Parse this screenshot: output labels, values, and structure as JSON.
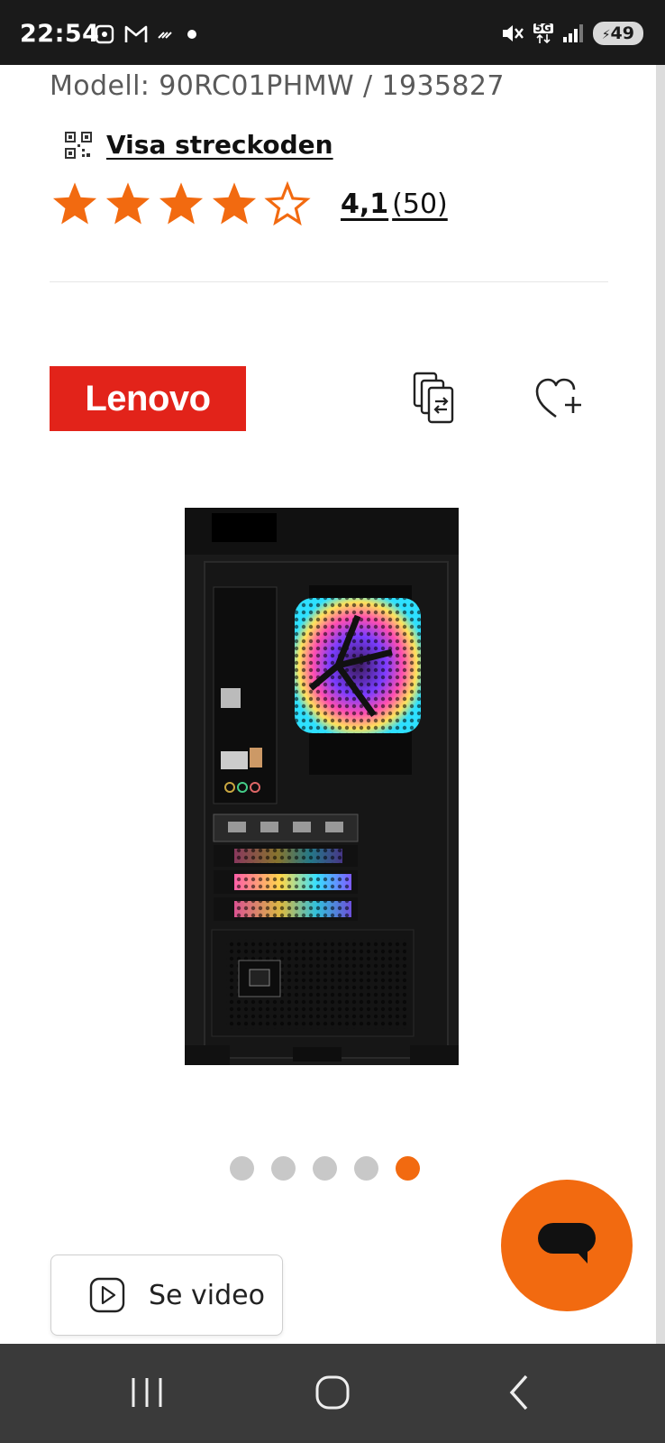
{
  "status_bar": {
    "time": "22:54",
    "battery": "49",
    "network": "5G"
  },
  "product": {
    "model_line": "Modell: 90RC01PHMW / 1935827",
    "barcode_link": "Visa streckoden",
    "rating": {
      "value": 4.1,
      "value_text": "4,1",
      "count_text": "(50)",
      "stars_filled": 4,
      "stars_total": 5
    },
    "brand_logo": "Lenovo"
  },
  "gallery": {
    "image_count": 5,
    "active_index": 4
  },
  "video_button": {
    "label": "Se video"
  },
  "icons": {
    "barcode": "qr-code-icon",
    "compare": "compare-icon",
    "favorite": "heart-plus-icon",
    "play": "play-icon",
    "chat": "chat-bubble-icon"
  },
  "colors": {
    "accent": "#f26a10",
    "star": "#f26a10",
    "brand_red": "#e2231a",
    "status_bar": "#1a1a1a",
    "nav_bar": "#3a3a3a"
  },
  "navigation": {
    "recent": "recent-apps-icon",
    "home": "home-icon",
    "back": "back-icon"
  }
}
